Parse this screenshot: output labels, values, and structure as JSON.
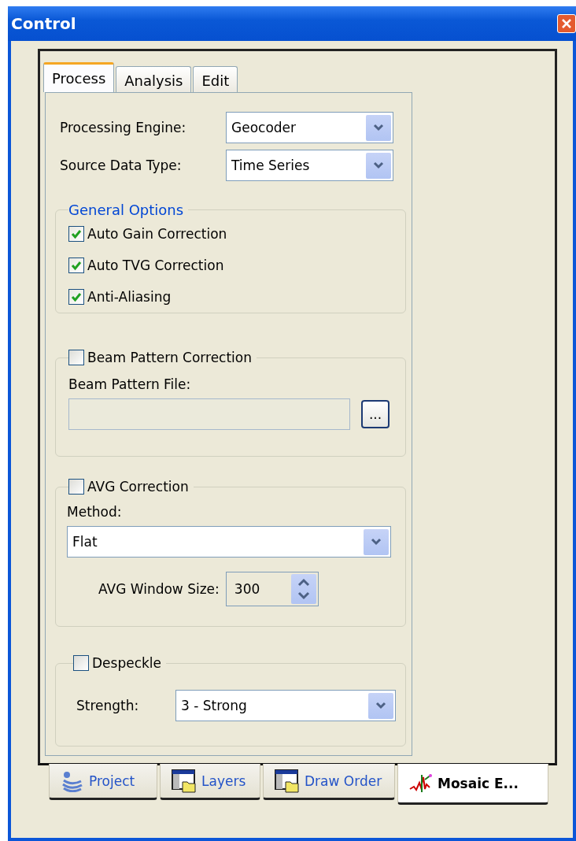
{
  "window": {
    "title": "Control"
  },
  "tabs": [
    {
      "label": "Process",
      "selected": true
    },
    {
      "label": "Analysis",
      "selected": false
    },
    {
      "label": "Edit",
      "selected": false
    }
  ],
  "fields": [
    {
      "label": "Processing Engine:",
      "value": "Geocoder"
    },
    {
      "label": "Source Data Type:",
      "value": "Time Series"
    }
  ],
  "general_options": {
    "title": "General Options",
    "options": [
      {
        "label": "Auto Gain Correction",
        "checked": true
      },
      {
        "label": "Auto TVG Correction",
        "checked": true
      },
      {
        "label": "Anti-Aliasing",
        "checked": true
      }
    ]
  },
  "beam_pattern": {
    "label": "Beam Pattern Correction",
    "checked": false,
    "file_label": "Beam Pattern File:",
    "browse_button": "..."
  },
  "avg": {
    "label": "AVG Correction",
    "checked": false,
    "method_label": "Method:",
    "method": "Flat",
    "window_size_label": "AVG Window Size:",
    "window_size": "300"
  },
  "despeckle": {
    "label": "Despeckle",
    "checked": false,
    "strength_label": "Strength:",
    "strength": "3 - Strong"
  },
  "bottom_tabs": [
    {
      "label": "Project",
      "selected": false,
      "kind": "project"
    },
    {
      "label": "Layers",
      "selected": false,
      "kind": "layers"
    },
    {
      "label": "Draw Order",
      "selected": false,
      "kind": "layers"
    },
    {
      "label": "Mosaic E...",
      "selected": true,
      "kind": "mosaic"
    }
  ]
}
